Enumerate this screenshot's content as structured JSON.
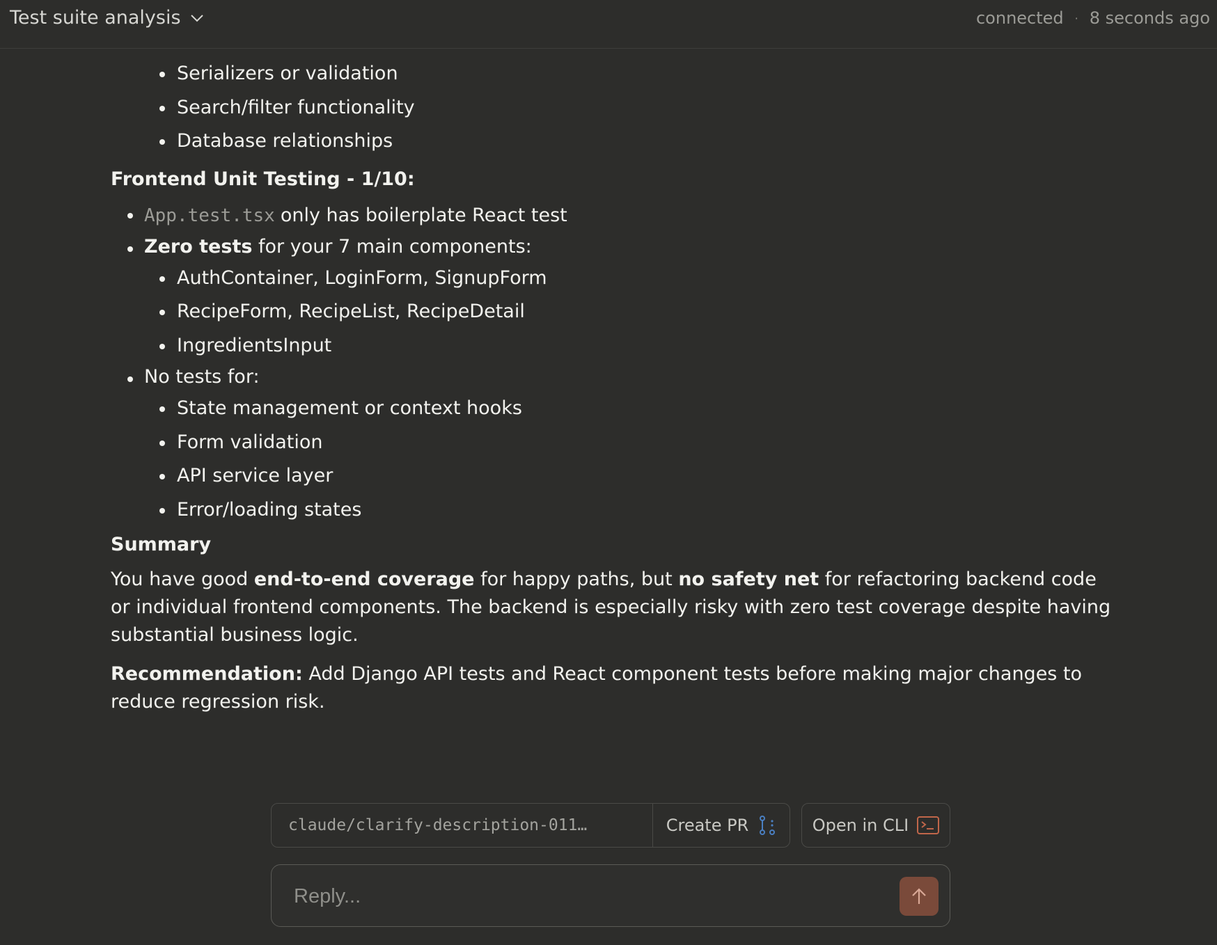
{
  "header": {
    "title": "Test suite analysis",
    "status": "connected",
    "separator": "·",
    "time_ago": "8 seconds ago"
  },
  "backend_items": [
    "Serializers or validation",
    "Search/filter functionality",
    "Database relationships"
  ],
  "frontend": {
    "heading": "Frontend Unit Testing - 1/10:",
    "item1_code": "App.test.tsx",
    "item1_text": "only has boilerplate React test",
    "item2_bold": "Zero tests",
    "item2_text": "for your 7 main components:",
    "components": [
      "AuthContainer, LoginForm, SignupForm",
      "RecipeForm, RecipeList, RecipeDetail",
      "IngredientsInput"
    ],
    "item3_text": "No tests for:",
    "missing": [
      "State management or context hooks",
      "Form validation",
      "API service layer",
      "Error/loading states"
    ]
  },
  "summary": {
    "heading": "Summary",
    "p_part1": "You have good ",
    "p_bold1": "end-to-end coverage",
    "p_part2": " for happy paths, but ",
    "p_bold2": "no safety net",
    "p_part3": " for refactoring backend code or individual frontend components. The backend is especially risky with zero test coverage despite having substantial business logic.",
    "rec_label": "Recommendation:",
    "rec_text": " Add Django API tests and React component tests before making major changes to reduce regression risk."
  },
  "actions": {
    "branch": "claude/clarify-description-011…",
    "create_pr": "Create PR",
    "open_cli": "Open in CLI"
  },
  "reply": {
    "placeholder": "Reply..."
  },
  "colors": {
    "background": "#2d2d2b",
    "send_button": "#7a4a3a",
    "pr_icon": "#4a7fc1",
    "cli_icon": "#c0664a"
  }
}
